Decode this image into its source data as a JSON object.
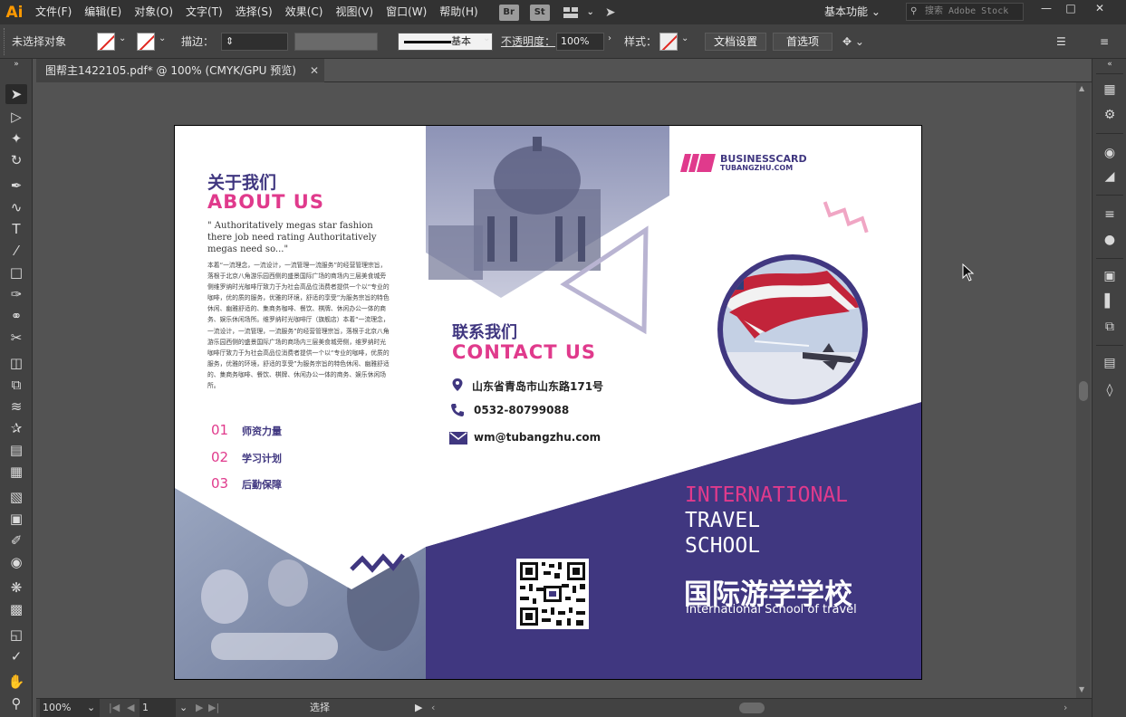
{
  "app": {
    "logo": "Ai",
    "menu": [
      "文件(F)",
      "编辑(E)",
      "对象(O)",
      "文字(T)",
      "选择(S)",
      "效果(C)",
      "视图(V)",
      "窗口(W)",
      "帮助(H)"
    ],
    "bridge_icon": "Br",
    "stock_icon": "St",
    "workspace": "基本功能",
    "stock_search_placeholder": "搜索 Adobe Stock"
  },
  "control_bar": {
    "selection": "未选择对象",
    "stroke_label": "描边：",
    "stroke_style": "基本",
    "opacity_label": "不透明度：",
    "opacity_value": "100%",
    "style_label": "样式：",
    "doc_settings": "文档设置",
    "preferences": "首选项"
  },
  "document": {
    "tab_title": "图帮主1422105.pdf* @ 100% (CMYK/GPU 预览)"
  },
  "status_bar": {
    "zoom": "100%",
    "page": "1",
    "mode": "选择"
  },
  "artwork": {
    "about_cn": "关于我们",
    "about_en": "ABOUT US",
    "about_quote": "\" Authoritatively megas star fashion there job need rating Authoritatively megas need so...\"",
    "about_body": "本着“一流理念，一流设计，一流管理一流服务”的经营管理宗旨，落根于北京八角游乐园西侧的盛景国际广场的商场内三层美食城旁侧维罗纳时光咖啡厅致力于为社会高品位消费者提供一个以“专业的咖啡，优的质的服务，优雅的环境，舒适的享受”为服务宗旨的特色休闲、幽雅舒适的、集商务咖啡、餐饮、棋牌、休闲办公一体的商务、娱乐休闲场所。维罗纳时光咖啡厅（旗舰店）本着“一流理念，一流设计，一流管理，一流服务”的经营管理宗旨，落根于北京八角游乐园西侧的盛景国际广场的商场内三层美食城旁侧，维罗纳时光咖啡厅致力于为社会高品位消费者提供一个以“专业的咖啡，优质的服务，优雅的环境，舒适的享受”为服务宗旨的特色休闲、幽雅舒适的、集商务咖啡、餐饮、棋牌、休闲办公一体的商务、娱乐休闲场所。",
    "list": [
      {
        "num": "01",
        "label": "师资力量"
      },
      {
        "num": "02",
        "label": "学习计划"
      },
      {
        "num": "03",
        "label": "后勤保障"
      }
    ],
    "contact_cn": "联系我们",
    "contact_en": "CONTACT US",
    "address": "山东省青岛市山东路171号",
    "phone": "0532-80799088",
    "email": "wm@tubangzhu.com",
    "brand_name": "BUSINESSCARD",
    "brand_url": "TUBANGZHU.COM",
    "intl_1": "INTERNATIONAL",
    "intl_2": "TRAVEL",
    "intl_3": "SCHOOL",
    "school_cn": "国际游学学校",
    "school_en": "International School of travel",
    "colors": {
      "purple": "#403780",
      "pink": "#e03a8c",
      "light_pink": "#f0a6c4",
      "lavender": "#b9b4d2"
    }
  }
}
